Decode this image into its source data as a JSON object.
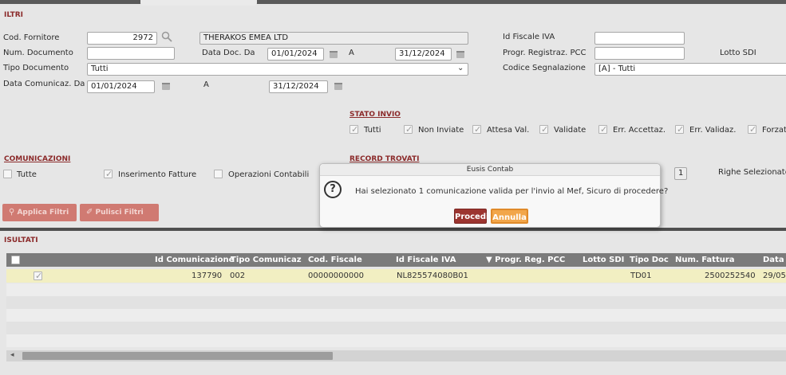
{
  "filters": {
    "title": "ILTRI",
    "cod_fornitore": {
      "label": "Cod. Fornitore",
      "value": "2972",
      "name": "THERAKOS EMEA LTD"
    },
    "num_documento": {
      "label": "Num. Documento",
      "value": ""
    },
    "tipo_documento": {
      "label": "Tipo Documento",
      "value": "Tutti"
    },
    "data_comunicaz": {
      "label": "Data Comunicaz. Da",
      "from": "01/01/2024",
      "a_label": "A",
      "to": "31/12/2024"
    },
    "data_doc": {
      "label": "Data Doc. Da",
      "from": "01/01/2024",
      "a_label": "A",
      "to": "31/12/2024"
    },
    "id_fiscale_iva": {
      "label": "Id Fiscale IVA",
      "value": ""
    },
    "progr_registraz_pcc": {
      "label": "Progr. Registraz. PCC",
      "value": ""
    },
    "lotto_sdi": {
      "label": "Lotto SDI"
    },
    "codice_segnalazione": {
      "label": "Codice Segnalazione",
      "value": "[A] - Tutti"
    }
  },
  "stato_invio": {
    "title": "STATO INVIO",
    "options": [
      "Tutti",
      "Non Inviate",
      "Attesa Val.",
      "Validate",
      "Err. Accettaz.",
      "Err. Validaz.",
      "Forzat"
    ]
  },
  "comunicazioni": {
    "title": "COMUNICAZIONI",
    "options": [
      "Tutte",
      "Inserimento Fatture",
      "Operazioni Contabili"
    ]
  },
  "record_trovati": {
    "title": "RECORD TROVATI",
    "count": "1",
    "righe_label": "Righe Selezionate"
  },
  "buttons": {
    "applica": "Applica Filtri",
    "pulisci": "Pulisci Filtri"
  },
  "results": {
    "title": "ISULTATI",
    "columns": [
      "Id Comunicazione",
      "Tipo Comunicaz",
      "Cod. Fiscale",
      "Id Fiscale IVA",
      "▼ Progr. Reg. PCC",
      "Lotto SDI",
      "Tipo Doc",
      "Num. Fattura",
      "Data E"
    ],
    "rows": [
      {
        "id": "137790",
        "tipo": "002",
        "cod_fiscale": "00000000000",
        "id_fiscale_iva": "NL825574080B01",
        "progr": "",
        "lotto": "",
        "tipo_doc": "TD01",
        "num_fattura": "2500252540",
        "data": "29/05"
      }
    ]
  },
  "dialog": {
    "title": "Eusis Contab",
    "message": "Hai selezionato 1 comunicazione valida per l'invio al Mef, Sicuro di procedere?",
    "procedi": "Procedi",
    "annulla": "Annulla"
  }
}
